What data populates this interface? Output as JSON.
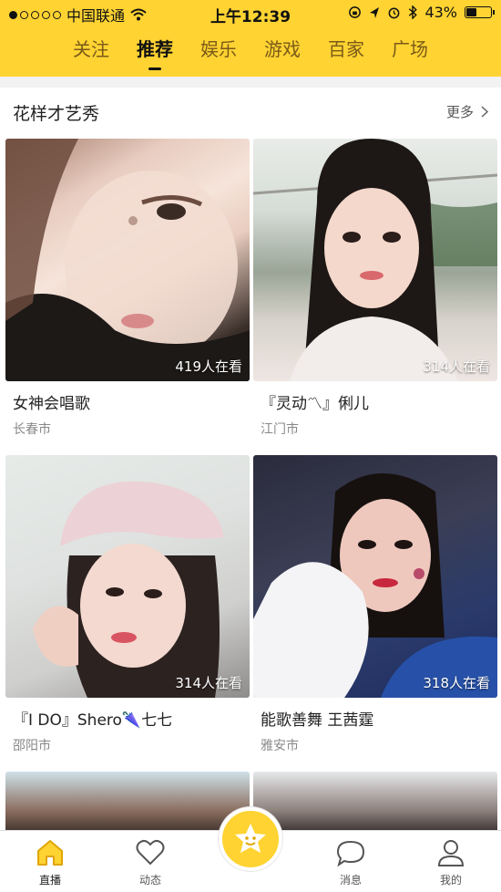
{
  "status_bar": {
    "carrier": "中国联通",
    "time": "上午12:39",
    "battery_percent": "43%",
    "battery_level": 0.43
  },
  "tabs": [
    {
      "label": "关注",
      "active": false
    },
    {
      "label": "推荐",
      "active": true
    },
    {
      "label": "娱乐",
      "active": false
    },
    {
      "label": "游戏",
      "active": false
    },
    {
      "label": "百家",
      "active": false
    },
    {
      "label": "广场",
      "active": false
    }
  ],
  "section": {
    "title": "花样才艺秀",
    "more_label": "更多"
  },
  "cards": [
    {
      "viewers": "419人在看",
      "title": "女神会唱歌",
      "city": "长春市"
    },
    {
      "viewers": "314人在看",
      "title": "『灵动〽』俐儿",
      "city": "江门市"
    },
    {
      "viewers": "314人在看",
      "title": "『I DO』Shero🌂七七",
      "city": "邵阳市"
    },
    {
      "viewers": "318人在看",
      "title": "能歌善舞 王茜霆",
      "city": "雅安市"
    }
  ],
  "bottom_nav": [
    {
      "label": "直播",
      "icon": "home-icon",
      "active": true
    },
    {
      "label": "动态",
      "icon": "heart-icon",
      "active": false
    },
    {
      "label": "",
      "icon": "star-smile-icon",
      "active": false
    },
    {
      "label": "消息",
      "icon": "message-icon",
      "active": false
    },
    {
      "label": "我的",
      "icon": "profile-icon",
      "active": false
    }
  ],
  "colors": {
    "accent": "#ffd332",
    "nav_active": "#f0b400"
  }
}
